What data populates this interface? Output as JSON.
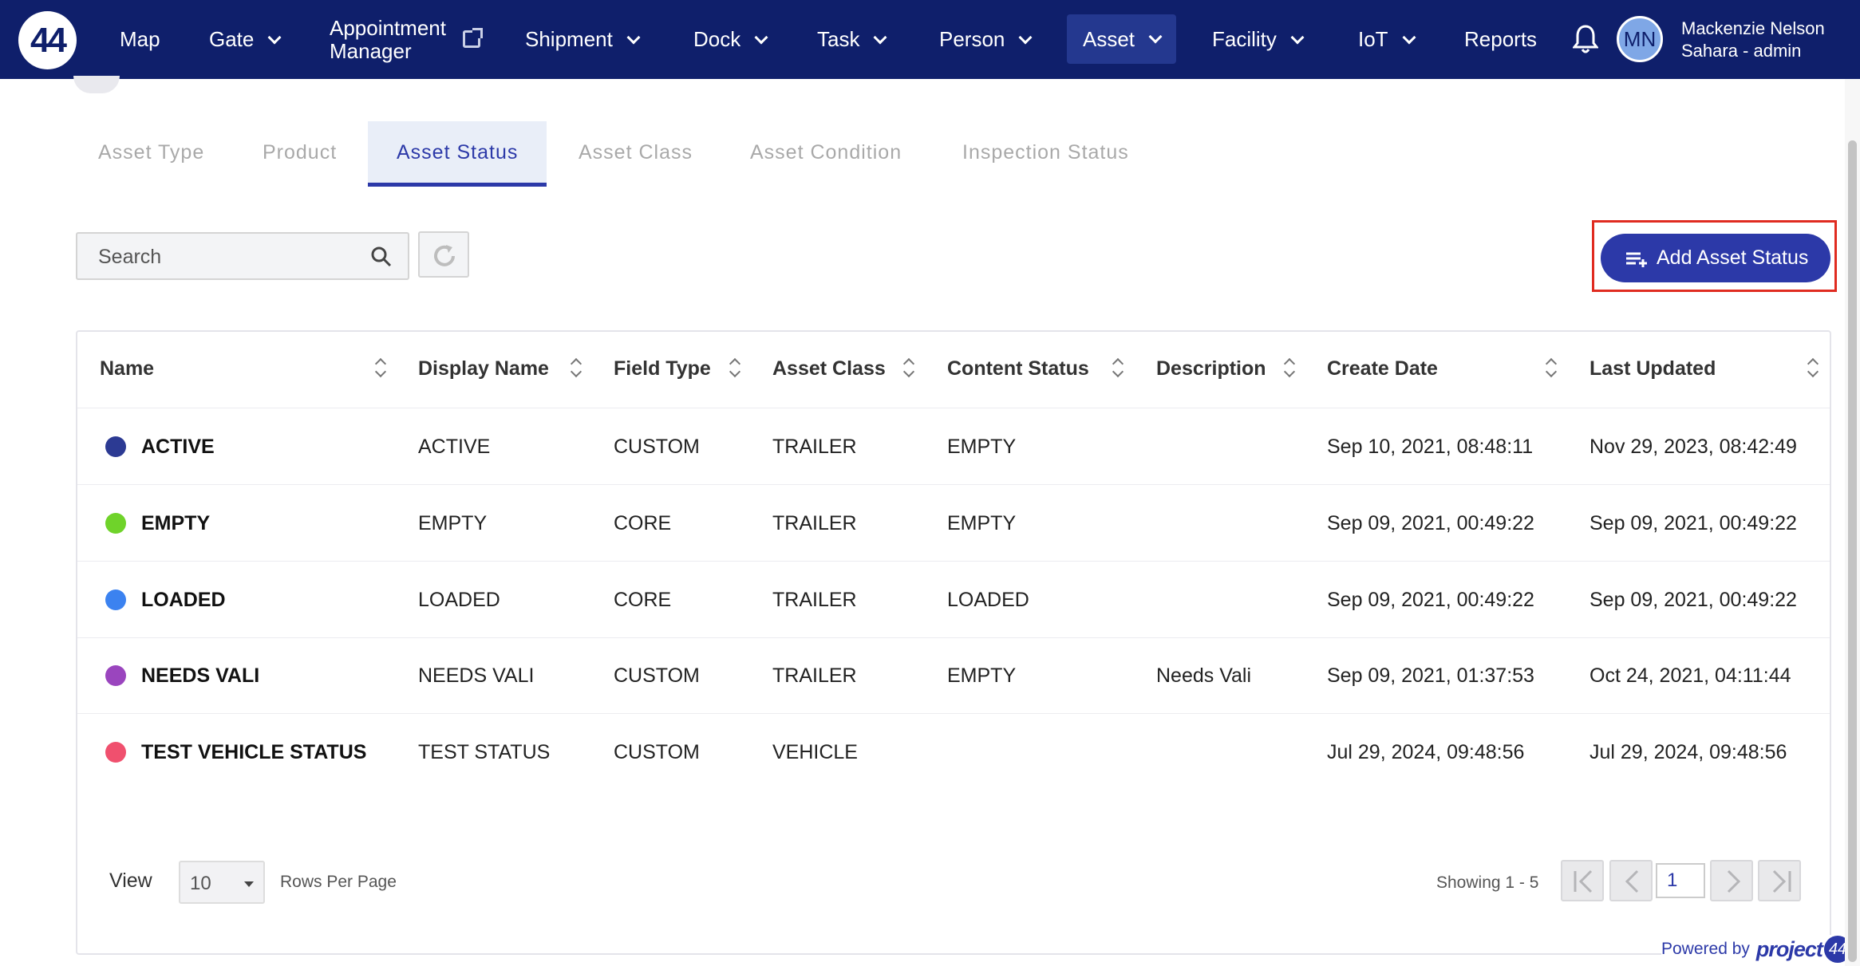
{
  "nav": {
    "logo": "44",
    "items": [
      {
        "label": "Map"
      },
      {
        "label": "Gate"
      },
      {
        "label": "Appointment",
        "label2": "Manager"
      },
      {
        "label": "Shipment"
      },
      {
        "label": "Dock"
      },
      {
        "label": "Task"
      },
      {
        "label": "Person"
      },
      {
        "label": "Asset"
      },
      {
        "label": "Facility"
      },
      {
        "label": "IoT"
      },
      {
        "label": "Reports"
      }
    ],
    "avatar_initials": "MN",
    "user_name": "Mackenzie Nelson",
    "user_role": "Sahara - admin"
  },
  "tabs": [
    {
      "label": "Asset Type"
    },
    {
      "label": "Product"
    },
    {
      "label": "Asset Status"
    },
    {
      "label": "Asset Class"
    },
    {
      "label": "Asset Condition"
    },
    {
      "label": "Inspection Status"
    }
  ],
  "toolbar": {
    "search_placeholder": "Search",
    "add_label": "Add Asset Status"
  },
  "table": {
    "columns": [
      "Name",
      "Display Name",
      "Field Type",
      "Asset Class",
      "Content Status",
      "Description",
      "Create Date",
      "Last Updated"
    ],
    "rows": [
      {
        "color": "#2c3a93",
        "name": "ACTIVE",
        "display": "ACTIVE",
        "field_type": "CUSTOM",
        "asset_class": "TRAILER",
        "content_status": "EMPTY",
        "description": "",
        "created": "Sep 10, 2021, 08:48:11",
        "updated": "Nov 29, 2023, 08:42:49"
      },
      {
        "color": "#6fd32a",
        "name": "EMPTY",
        "display": "EMPTY",
        "field_type": "CORE",
        "asset_class": "TRAILER",
        "content_status": "EMPTY",
        "description": "",
        "created": "Sep 09, 2021, 00:49:22",
        "updated": "Sep 09, 2021, 00:49:22"
      },
      {
        "color": "#3b82f0",
        "name": "LOADED",
        "display": "LOADED",
        "field_type": "CORE",
        "asset_class": "TRAILER",
        "content_status": "LOADED",
        "description": "",
        "created": "Sep 09, 2021, 00:49:22",
        "updated": "Sep 09, 2021, 00:49:22"
      },
      {
        "color": "#9a45be",
        "name": "NEEDS VALI",
        "display": "NEEDS VALI",
        "field_type": "CUSTOM",
        "asset_class": "TRAILER",
        "content_status": "EMPTY",
        "description": "Needs Vali",
        "created": "Sep 09, 2021, 01:37:53",
        "updated": "Oct 24, 2021, 04:11:44"
      },
      {
        "color": "#f0506e",
        "name": "TEST VEHICLE STATUS",
        "display": "TEST STATUS",
        "field_type": "CUSTOM",
        "asset_class": "VEHICLE",
        "content_status": "",
        "description": "",
        "created": "Jul 29, 2024, 09:48:56",
        "updated": "Jul 29, 2024, 09:48:56"
      }
    ]
  },
  "footer": {
    "view_label": "View",
    "rows_per_page": "10",
    "rows_label": "Rows Per Page",
    "showing": "Showing 1 - 5",
    "page": "1",
    "powered_by": "Powered by",
    "brand": "project",
    "brand_num": "44"
  },
  "colors": {
    "nav_bg": "#0f1f6b",
    "accent": "#2c39a8",
    "highlight": "#e02b20"
  }
}
